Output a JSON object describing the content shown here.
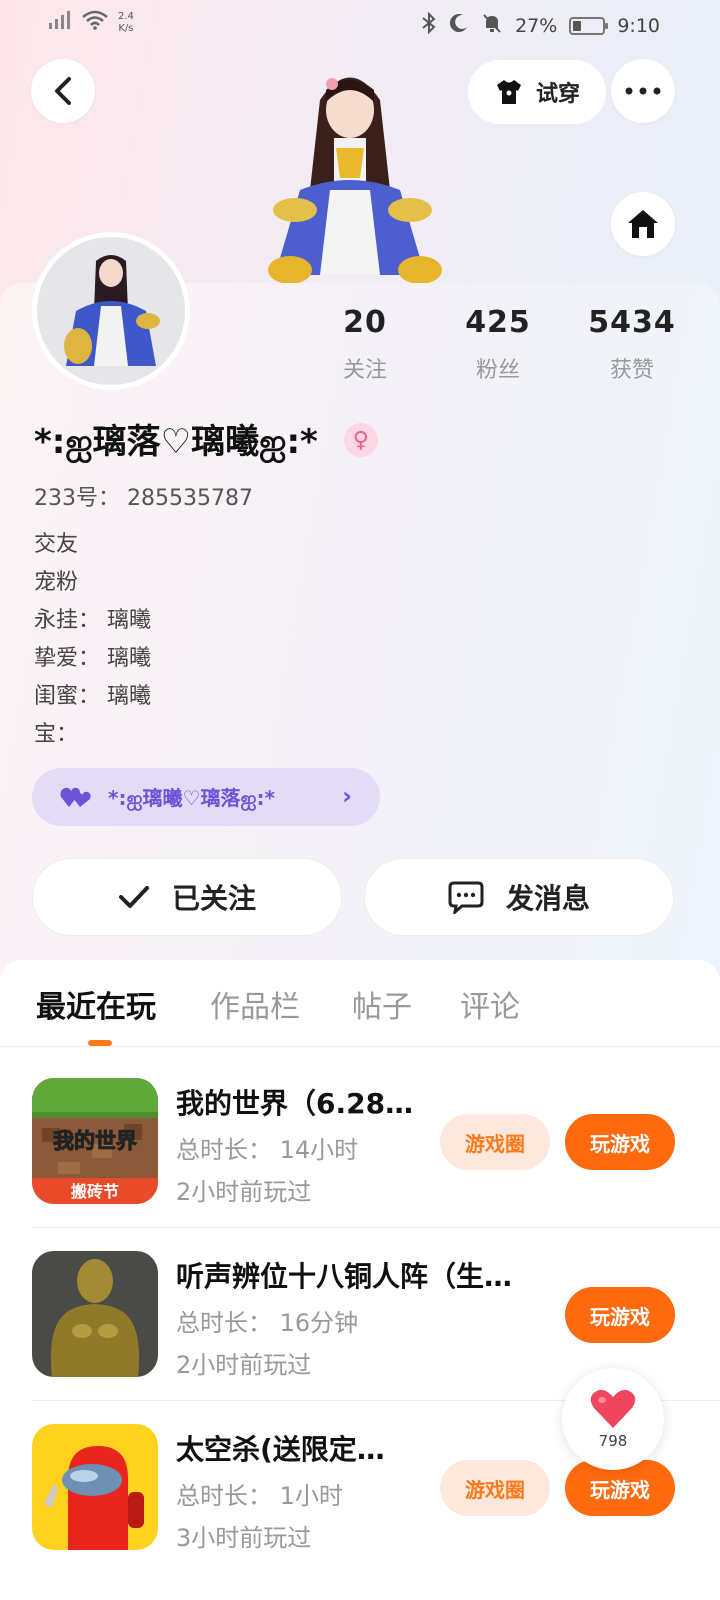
{
  "status_bar": {
    "net_speed_top": "2.4",
    "net_speed_bottom": "K/s",
    "battery": "27%",
    "time": "9:10"
  },
  "header": {
    "try_on_label": "试穿"
  },
  "profile": {
    "stats": [
      {
        "value": "20",
        "label": "关注"
      },
      {
        "value": "425",
        "label": "粉丝"
      },
      {
        "value": "5434",
        "label": "获赞"
      }
    ],
    "nickname": "*:ஐ璃落♡璃曦ஐ:*",
    "gender_symbol": "♀",
    "uid": "233号：  285535787",
    "bio_lines": [
      "交友",
      "宠粉",
      "永挂：  璃曦",
      "挚爱：  璃曦",
      "闺蜜：  璃曦",
      "宝："
    ],
    "cp_name": "*:ஐ璃曦♡璃落ஐ:*",
    "follow_label": "已关注",
    "message_label": "发消息"
  },
  "tabs": [
    "最近在玩",
    "作品栏",
    "帖子",
    "评论"
  ],
  "games": [
    {
      "title": "我的世界（6.28…",
      "duration": "总时长：  14小时",
      "last_played": "2小时前玩过",
      "circle_label": "游戏圈",
      "play_label": "玩游戏",
      "icon_text_main": "我的世界",
      "icon_text_sub": "搬砖节"
    },
    {
      "title": "听声辨位十八铜人阵（生…",
      "duration": "总时长：  16分钟",
      "last_played": "2小时前玩过",
      "play_label": "玩游戏"
    },
    {
      "title": "太空杀(送限定…",
      "duration": "总时长：  1小时",
      "last_played": "3小时前玩过",
      "circle_label": "游戏圈",
      "play_label": "玩游戏"
    }
  ],
  "like_count": "798",
  "colors": {
    "accent": "#ff6a0e",
    "accent_soft": "#fde8de",
    "cp_purple": "#6a55d8",
    "gender_pink": "#ef5e8d"
  }
}
